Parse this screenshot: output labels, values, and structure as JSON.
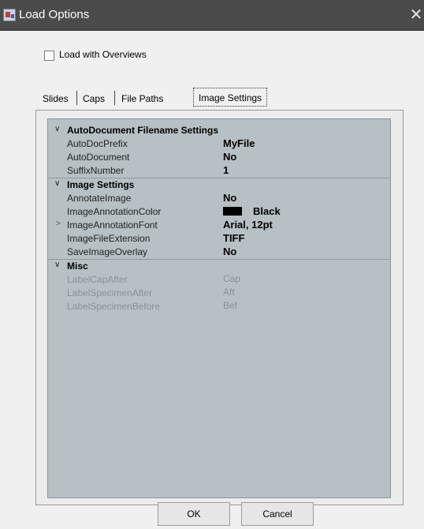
{
  "window": {
    "title": "Load Options",
    "close_glyph": "✕",
    "icon": "app-icon"
  },
  "options": {
    "load_with_overviews_label": "Load with Overviews",
    "load_with_overviews_checked": false
  },
  "tabs": [
    {
      "label": "Slides"
    },
    {
      "label": "Caps"
    },
    {
      "label": "File Paths"
    },
    {
      "label": "Image Settings",
      "active": true
    }
  ],
  "property_grid": {
    "categories": [
      {
        "label": "AutoDocument Filename Settings",
        "expanded": true,
        "properties": [
          {
            "name": "AutoDocPrefix",
            "value": "MyFile"
          },
          {
            "name": "AutoDocument",
            "value": "No"
          },
          {
            "name": "SuffixNumber",
            "value": "1"
          }
        ]
      },
      {
        "label": "Image Settings",
        "expanded": true,
        "properties": [
          {
            "name": "AnnotateImage",
            "value": "No"
          },
          {
            "name": "ImageAnnotationColor",
            "value": "Black",
            "swatch_color": "#000000"
          },
          {
            "name": "ImageAnnotationFont",
            "value": "Arial, 12pt",
            "expandable": true
          },
          {
            "name": "ImageFileExtension",
            "value": "TIFF"
          },
          {
            "name": "SaveImageOverlay",
            "value": "No"
          }
        ]
      },
      {
        "label": "Misc",
        "expanded": true,
        "properties": [
          {
            "name": "LabelCapAfter",
            "value": "Cap",
            "disabled": true
          },
          {
            "name": "LabelSpecimenAfter",
            "value": "Aft",
            "disabled": true
          },
          {
            "name": "LabelSpecimenBefore",
            "value": "Bef",
            "disabled": true
          }
        ]
      }
    ]
  },
  "buttons": {
    "ok_label": "OK",
    "cancel_label": "Cancel"
  },
  "colors": {
    "titlebar": "#4b4b4b",
    "grid_background": "#b7c0c4",
    "disabled_text": "#8a9296"
  }
}
